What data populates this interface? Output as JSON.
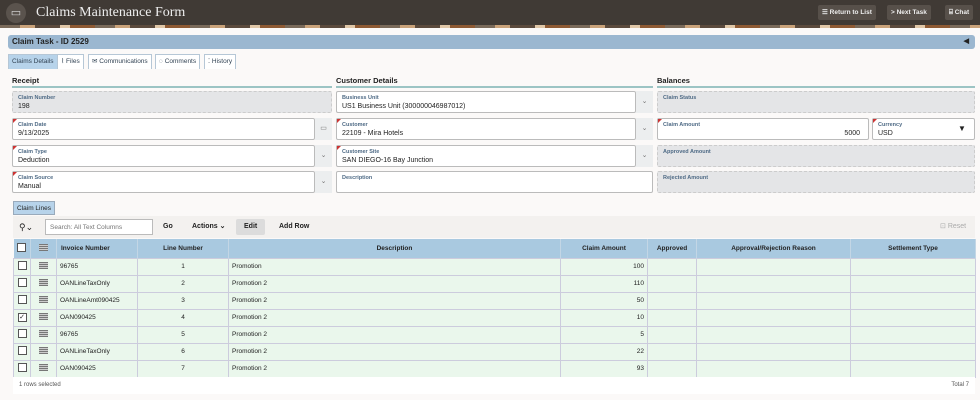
{
  "app": {
    "title": "Claims Maintenance Form",
    "logo_icon": "card-icon"
  },
  "header_buttons": [
    {
      "label": "Return to List",
      "icon": "list-icon"
    },
    {
      "label": "Next Task",
      "icon": "chevron-right-icon"
    },
    {
      "label": "Chat",
      "icon": "chat-icon"
    }
  ],
  "task_title": "Claim Task - ID 2529",
  "tabs": [
    {
      "label": "Claims Details",
      "icon": ""
    },
    {
      "label": "Files",
      "icon": "paperclip-icon"
    },
    {
      "label": "Communications",
      "icon": "mail-icon"
    },
    {
      "label": "Comments",
      "icon": "comment-icon"
    },
    {
      "label": "History",
      "icon": "history-icon"
    }
  ],
  "sections": {
    "receipt": "Receipt",
    "customer": "Customer Details",
    "balances": "Balances"
  },
  "receipt": [
    {
      "label": "Claim Number",
      "value": "198"
    },
    {
      "label": "Claim Date",
      "value": "9/13/2025"
    },
    {
      "label": "Claim Type",
      "value": "Deduction"
    },
    {
      "label": "Claim Source",
      "value": "Manual"
    }
  ],
  "customer": [
    {
      "label": "Business Unit",
      "value": "US1 Business Unit (300000046987012)"
    },
    {
      "label": "Customer",
      "value": "22109 - Mira Hotels"
    },
    {
      "label": "Customer Site",
      "value": "SAN DIEGO-16 Bay Junction"
    },
    {
      "label": "Description",
      "value": ""
    }
  ],
  "balances": {
    "claim_status": {
      "label": "Claim Status",
      "value": ""
    },
    "claim_amount": {
      "label": "Claim Amount",
      "value": "5000"
    },
    "currency": {
      "label": "Currency",
      "value": "USD"
    },
    "approved": {
      "label": "Approved Amount",
      "value": ""
    },
    "rejected": {
      "label": "Rejected Amount",
      "value": ""
    }
  },
  "claim_lines": {
    "tab": "Claim Lines",
    "search_placeholder": "Search: All Text Columns",
    "go": "Go",
    "actions": "Actions",
    "edit": "Edit",
    "add_row": "Add Row",
    "reset": "Reset",
    "columns": [
      "Invoice Number",
      "Line Number",
      "Description",
      "Claim Amount",
      "Approved",
      "Approval/Rejection Reason",
      "Settlement Type"
    ],
    "rows": [
      {
        "checked": false,
        "invoice": "96765",
        "line": "1",
        "desc": "Promotion",
        "amount": "100",
        "approved": "",
        "reason": "",
        "settlement": ""
      },
      {
        "checked": false,
        "invoice": "OANLineTaxOnly",
        "line": "2",
        "desc": "Promotion 2",
        "amount": "110",
        "approved": "",
        "reason": "",
        "settlement": ""
      },
      {
        "checked": false,
        "invoice": "OANLineAmt090425",
        "line": "3",
        "desc": "Promotion 2",
        "amount": "50",
        "approved": "",
        "reason": "",
        "settlement": ""
      },
      {
        "checked": true,
        "invoice": "OAN090425",
        "line": "4",
        "desc": "Promotion 2",
        "amount": "10",
        "approved": "",
        "reason": "",
        "settlement": ""
      },
      {
        "checked": false,
        "invoice": "96765",
        "line": "5",
        "desc": "Promotion 2",
        "amount": "5",
        "approved": "",
        "reason": "",
        "settlement": ""
      },
      {
        "checked": false,
        "invoice": "OANLineTaxOnly",
        "line": "6",
        "desc": "Promotion 2",
        "amount": "22",
        "approved": "",
        "reason": "",
        "settlement": ""
      },
      {
        "checked": false,
        "invoice": "OAN090425",
        "line": "7",
        "desc": "Promotion 2",
        "amount": "93",
        "approved": "",
        "reason": "",
        "settlement": ""
      }
    ],
    "selected_text": "1 rows selected",
    "total_text": "Total 7"
  }
}
